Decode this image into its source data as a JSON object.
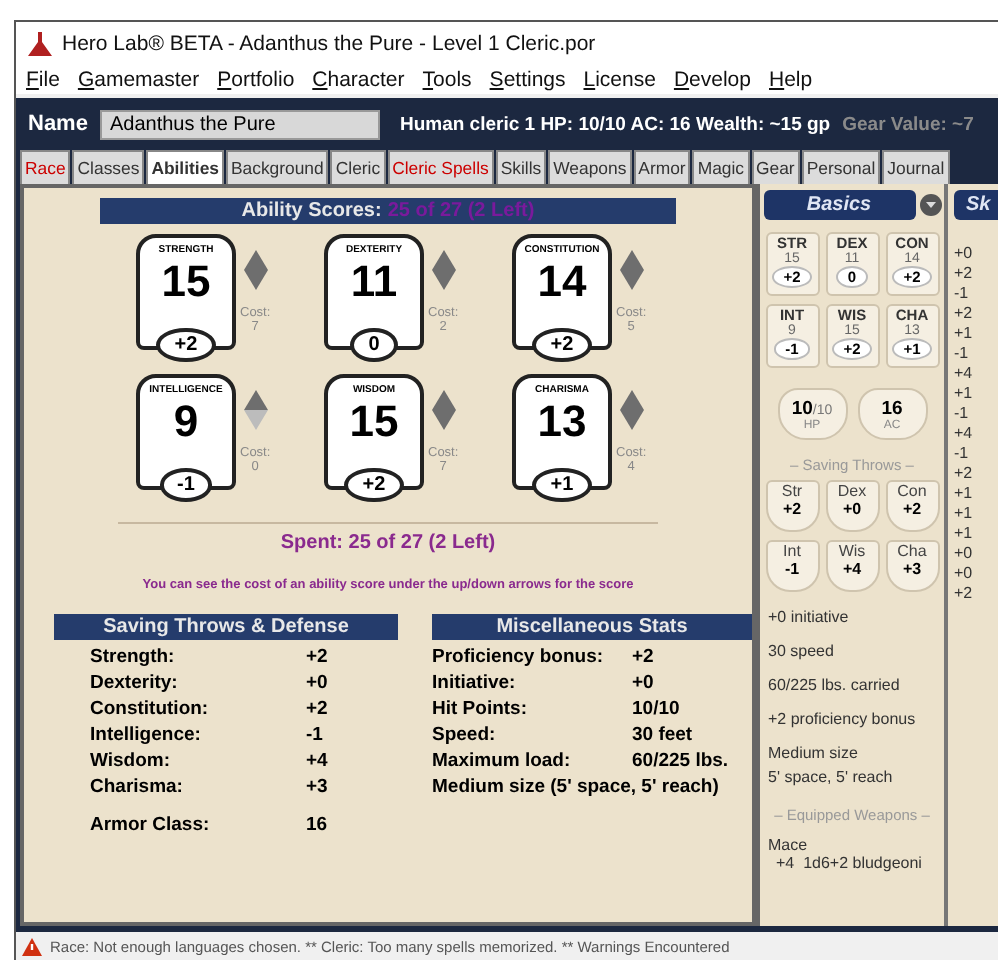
{
  "window": {
    "title": "Hero Lab® BETA  -  Adanthus the Pure  -  Level 1 Cleric.por"
  },
  "menu": [
    "File",
    "Gamemaster",
    "Portfolio",
    "Character",
    "Tools",
    "Settings",
    "License",
    "Develop",
    "Help"
  ],
  "name_bar": {
    "label": "Name",
    "value": "Adanthus the Pure",
    "summary": "Human cleric 1  HP: 10/10  AC: 16  Wealth: ~15 gp",
    "gear_value": "Gear Value: ~7"
  },
  "tabs": [
    {
      "label": "Race",
      "selected": false,
      "warning": true
    },
    {
      "label": "Classes",
      "selected": false,
      "warning": false
    },
    {
      "label": "Abilities",
      "selected": true,
      "warning": false
    },
    {
      "label": "Background",
      "selected": false,
      "warning": false
    },
    {
      "label": "Cleric",
      "selected": false,
      "warning": false
    },
    {
      "label": "Cleric Spells",
      "selected": false,
      "warning": true
    },
    {
      "label": "Skills",
      "selected": false,
      "warning": false
    },
    {
      "label": "Weapons",
      "selected": false,
      "warning": false
    },
    {
      "label": "Armor",
      "selected": false,
      "warning": false
    },
    {
      "label": "Magic",
      "selected": false,
      "warning": false
    },
    {
      "label": "Gear",
      "selected": false,
      "warning": false
    },
    {
      "label": "Personal",
      "selected": false,
      "warning": false
    },
    {
      "label": "Journal",
      "selected": false,
      "warning": false
    }
  ],
  "ability_scores": {
    "title": "Ability Scores:",
    "value": "25 of 27 (2 Left)",
    "abilities": [
      {
        "name": "STRENGTH",
        "score": "15",
        "modifier": "+2",
        "cost_label": "Cost:",
        "cost": "7",
        "can_decrease": true
      },
      {
        "name": "DEXTERITY",
        "score": "11",
        "modifier": "0",
        "cost_label": "Cost:",
        "cost": "2",
        "can_decrease": true
      },
      {
        "name": "CONSTITUTION",
        "score": "14",
        "modifier": "+2",
        "cost_label": "Cost:",
        "cost": "5",
        "can_decrease": true
      },
      {
        "name": "INTELLIGENCE",
        "score": "9",
        "modifier": "-1",
        "cost_label": "Cost:",
        "cost": "0",
        "can_decrease": false
      },
      {
        "name": "WISDOM",
        "score": "15",
        "modifier": "+2",
        "cost_label": "Cost:",
        "cost": "7",
        "can_decrease": true
      },
      {
        "name": "CHARISMA",
        "score": "13",
        "modifier": "+1",
        "cost_label": "Cost:",
        "cost": "4",
        "can_decrease": true
      }
    ],
    "spent": "Spent: 25 of 27 (2 Left)",
    "hint": "You can see the cost of an ability score under the up/down arrows for the score"
  },
  "saving_throws": {
    "title": "Saving Throws & Defense",
    "rows": [
      {
        "label": "Strength:",
        "value": "+2"
      },
      {
        "label": "Dexterity:",
        "value": "+0"
      },
      {
        "label": "Constitution:",
        "value": "+2"
      },
      {
        "label": "Intelligence:",
        "value": "-1"
      },
      {
        "label": "Wisdom:",
        "value": "+4"
      },
      {
        "label": "Charisma:",
        "value": "+3"
      }
    ],
    "armor_class": {
      "label": "Armor Class:",
      "value": "16"
    }
  },
  "misc_stats": {
    "title": "Miscellaneous Stats",
    "rows": [
      {
        "label": "Proficiency bonus:",
        "value": "+2"
      },
      {
        "label": "Initiative:",
        "value": "+0"
      },
      {
        "label": "Hit Points:",
        "value": "10/10"
      },
      {
        "label": "Speed:",
        "value": "30 feet"
      },
      {
        "label": "Maximum load:",
        "value": "60/225 lbs."
      }
    ],
    "size": "Medium size (5' space, 5' reach)"
  },
  "basics": {
    "title": "Basics",
    "abilities": [
      {
        "abbr": "STR",
        "score": "15",
        "modifier": "+2"
      },
      {
        "abbr": "DEX",
        "score": "11",
        "modifier": "0"
      },
      {
        "abbr": "CON",
        "score": "14",
        "modifier": "+2"
      },
      {
        "abbr": "INT",
        "score": "9",
        "modifier": "-1"
      },
      {
        "abbr": "WIS",
        "score": "15",
        "modifier": "+2"
      },
      {
        "abbr": "CHA",
        "score": "13",
        "modifier": "+1"
      }
    ],
    "hp": {
      "value": "10",
      "max": "/10",
      "label": "HP"
    },
    "ac": {
      "value": "16",
      "label": "AC"
    },
    "saves_title": "– Saving Throws –",
    "saves": [
      {
        "abbr": "Str",
        "value": "+2"
      },
      {
        "abbr": "Dex",
        "value": "+0"
      },
      {
        "abbr": "Con",
        "value": "+2"
      },
      {
        "abbr": "Int",
        "value": "-1"
      },
      {
        "abbr": "Wis",
        "value": "+4"
      },
      {
        "abbr": "Cha",
        "value": "+3"
      }
    ],
    "lines": [
      "+0  initiative",
      "30  speed",
      "60/225 lbs. carried",
      "+2 proficiency bonus"
    ],
    "size_lines": [
      "Medium size",
      "5' space, 5' reach"
    ],
    "weapons_title": "– Equipped Weapons –",
    "weapon": {
      "name": "Mace",
      "stats": "+4  1d6+2 bludgeoni"
    }
  },
  "skills": {
    "title": "Sk",
    "values": [
      "+0",
      "+2",
      "-1",
      "+2",
      "+1",
      "-1",
      "+4",
      "+1",
      "-1",
      "+4",
      "-1",
      "+2",
      "+1",
      "+1",
      "+1",
      "+0",
      "+0",
      "+2"
    ]
  },
  "status_bar": "Race: Not enough languages chosen. ** Cleric: Too many spells memorized. ** Warnings Encountered"
}
